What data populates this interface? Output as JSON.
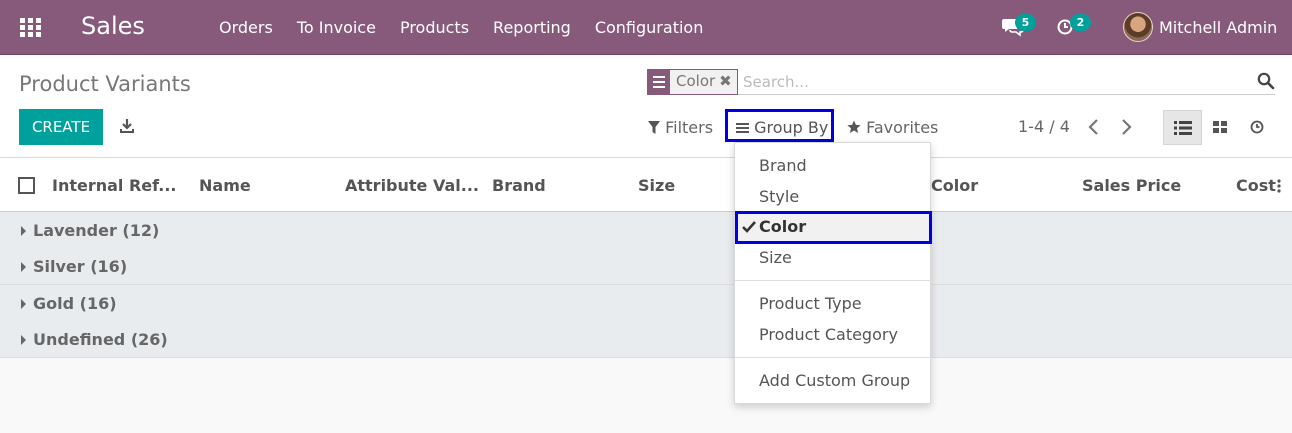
{
  "topbar": {
    "brand": "Sales",
    "menu": [
      "Orders",
      "To Invoice",
      "Products",
      "Reporting",
      "Configuration"
    ],
    "chat_count": "5",
    "activity_count": "2",
    "user_name": "Mitchell Admin"
  },
  "control": {
    "page_title": "Product Variants",
    "facet_value": "Color",
    "facet_close": "✖",
    "search_placeholder": "Search...",
    "create_label": "CREATE",
    "filters_label": "Filters",
    "groupby_label": "Group By",
    "favorites_label": "Favorites",
    "pager": "1-4 / 4"
  },
  "table": {
    "columns": [
      "Internal Ref...",
      "Name",
      "Attribute Val...",
      "Brand",
      "Size",
      "Color",
      "Sales Price",
      "Cost"
    ],
    "groups": [
      "Lavender (12)",
      "Silver (16)",
      "Gold (16)",
      "Undefined (26)"
    ]
  },
  "groupby_menu": {
    "items": [
      "Brand",
      "Style",
      "Color",
      "Size",
      "Product Type",
      "Product Category",
      "Add Custom Group"
    ],
    "selected": "Color"
  },
  "colors": {
    "brand": "#875a7b",
    "primary": "#00a09d",
    "highlight": "#0000e5"
  }
}
